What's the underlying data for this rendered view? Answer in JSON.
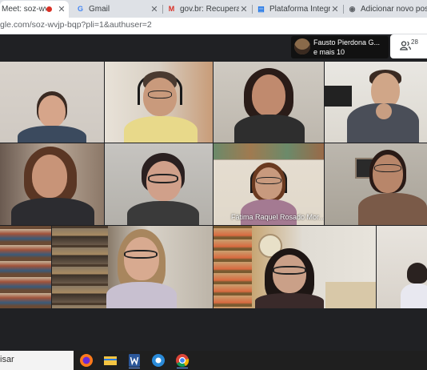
{
  "tabs": [
    {
      "title": "Meet: soz-wvjp-bq"
    },
    {
      "title": "Gmail",
      "icon": "G"
    },
    {
      "title": "gov.br: Recuperação de",
      "icon": "M"
    },
    {
      "title": "Plataforma Íntegra - Co",
      "icon": "▤"
    },
    {
      "title": "Adicionar novo post ‹ I",
      "icon": "◉"
    }
  ],
  "address_bar": {
    "url": "gle.com/soz-wvjp-bqp?pli=1&authuser=2"
  },
  "participants": {
    "name": "Fausto Pierdona G...",
    "more": "e mais 10",
    "count": "28"
  },
  "tiles": [
    {
      "name": ""
    },
    {
      "name": ""
    },
    {
      "name": ""
    },
    {
      "name": ""
    },
    {
      "name": ""
    },
    {
      "name": ""
    },
    {
      "name": "Fátima Raquel Rosado Mor..."
    },
    {
      "name": ""
    },
    {
      "name": ""
    },
    {
      "name": ""
    },
    {
      "name": ""
    },
    {
      "name": ""
    }
  ],
  "taskbar": {
    "search_text": "isar"
  }
}
